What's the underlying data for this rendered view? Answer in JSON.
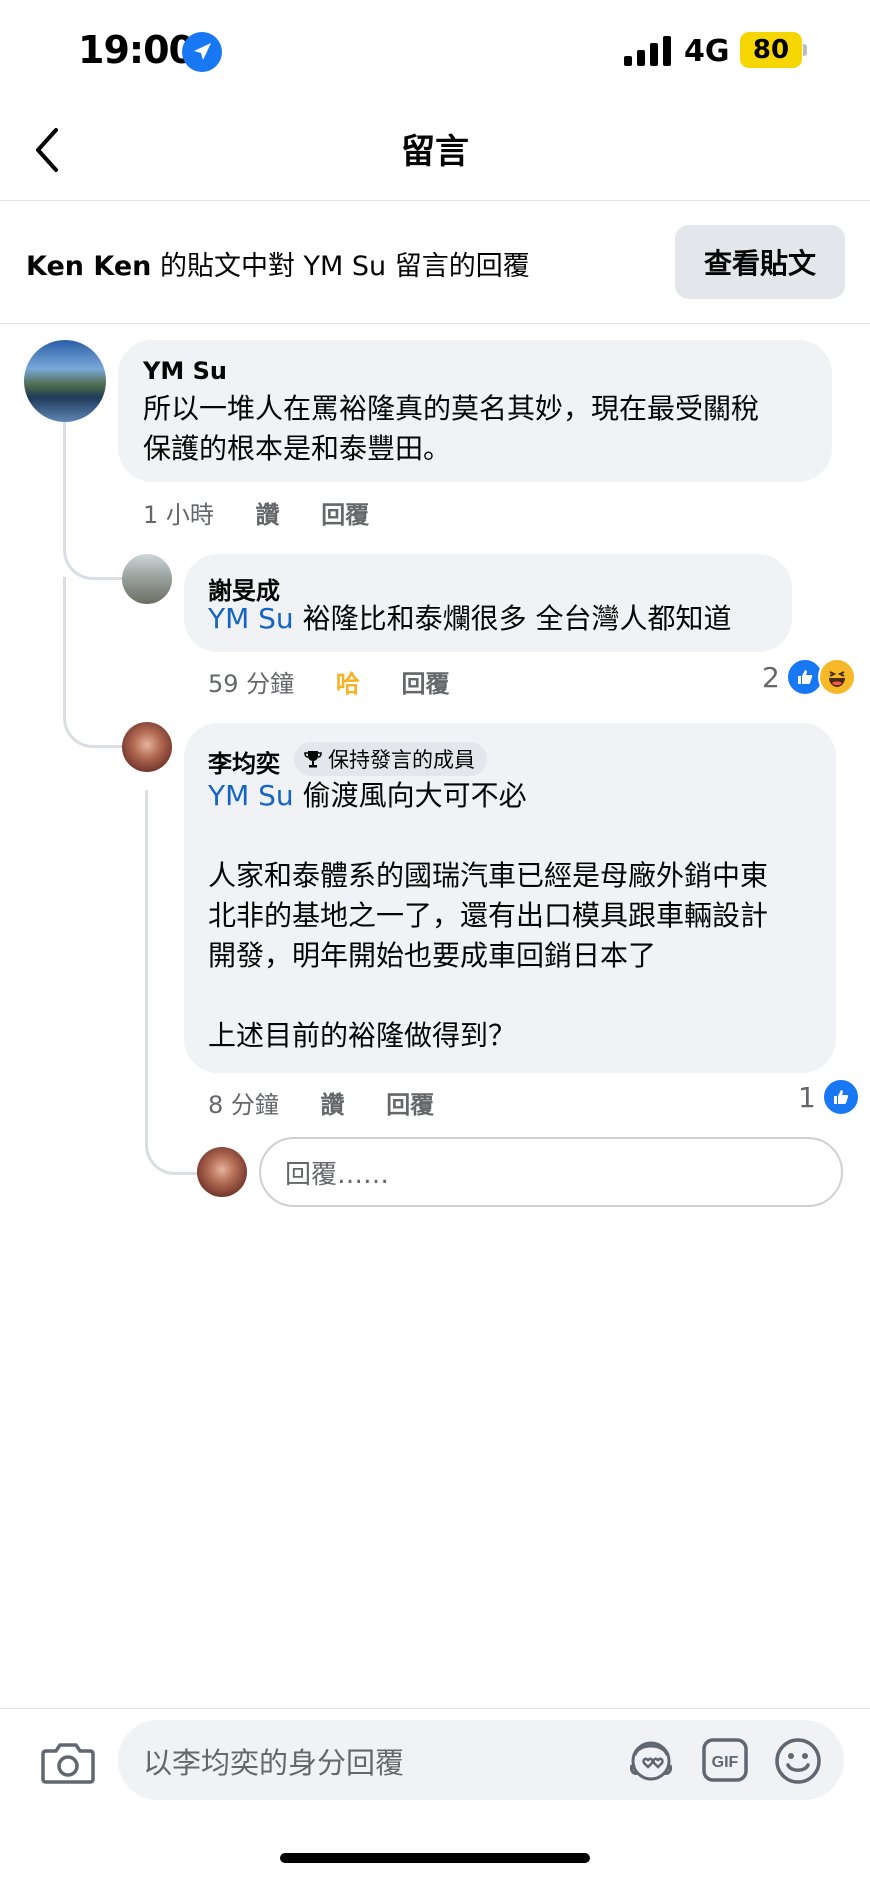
{
  "status_bar": {
    "time": "19:00",
    "network": "4G",
    "battery": "80"
  },
  "header": {
    "title": "留言"
  },
  "context": {
    "page_owner": "Ken Ken",
    "text_1": " 的貼文中對 ",
    "commenter": "YM Su",
    "text_2": " 留言的回覆",
    "view_post_label": "查看貼文"
  },
  "comments": [
    {
      "author": "YM Su",
      "text": "所以一堆人在罵裕隆真的莫名其妙，現在最受關稅\n保護的根本是和泰豐田。",
      "time": "1 小時",
      "like_label": "讚",
      "reply_label": "回覆"
    },
    {
      "author": "謝旻成",
      "mention": "YM Su",
      "text": " 裕隆比和泰爛很多 全台灣人都知道",
      "time": "59 分鐘",
      "reaction_label": "哈",
      "reply_label": "回覆",
      "reaction_count": "2",
      "reactions": [
        "like-icon",
        "haha-icon"
      ]
    },
    {
      "author": "李均奕",
      "badge": "保持發言的成員",
      "mention": "YM Su",
      "text": " 偷渡風向大可不必\n\n人家和泰體系的國瑞汽車已經是母廠外銷中東\n北非的基地之一了，還有出口模具跟車輛設計\n開發，明年開始也要成車回銷日本了\n\n上述目前的裕隆做得到？",
      "time": "8 分鐘",
      "like_label": "讚",
      "reply_label": "回覆",
      "reaction_count": "1",
      "reactions": [
        "like-icon"
      ]
    }
  ],
  "reply_box": {
    "placeholder": "回覆……"
  },
  "composer": {
    "placeholder": "以李均奕的身分回覆"
  },
  "colors": {
    "mention": "#1565c0",
    "bubble": "#f0f2f5",
    "haha": "#f7b125",
    "like_blue": "#1877f2",
    "battery": "#f6d600"
  }
}
